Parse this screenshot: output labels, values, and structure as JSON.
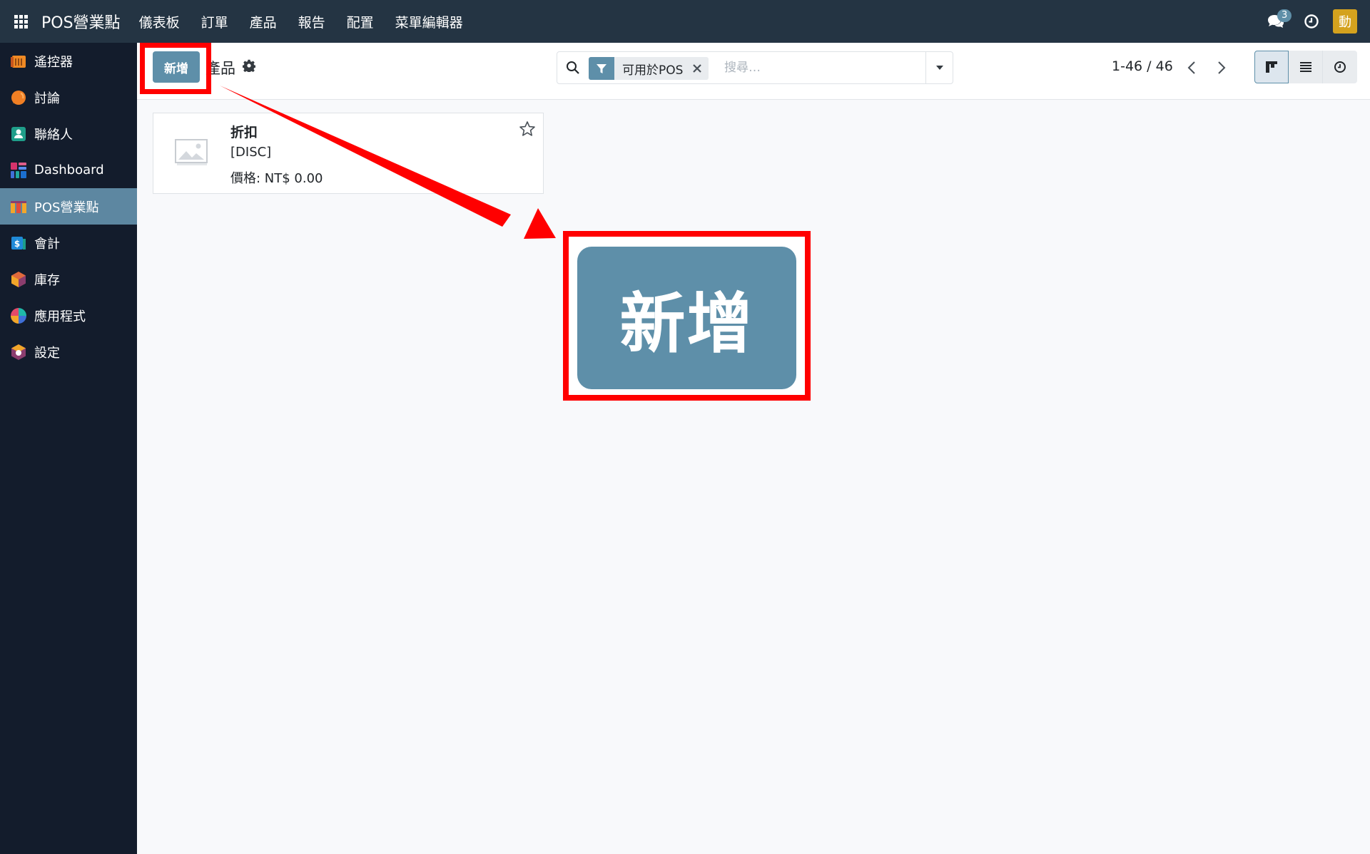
{
  "topbar": {
    "brand": "POS營業點",
    "menu": [
      "儀表板",
      "訂單",
      "產品",
      "報告",
      "配置",
      "菜單編輯器"
    ],
    "chat_count": "3",
    "avatar_letter": "動"
  },
  "sidebar": {
    "items": [
      {
        "label": "遙控器",
        "icon": "remote-icon"
      },
      {
        "label": "討論",
        "icon": "discuss-icon"
      },
      {
        "label": "聯絡人",
        "icon": "contacts-icon"
      },
      {
        "label": "Dashboard",
        "icon": "dashboard-icon"
      },
      {
        "label": "POS營業點",
        "icon": "pos-icon"
      },
      {
        "label": "會計",
        "icon": "accounting-icon"
      },
      {
        "label": "庫存",
        "icon": "inventory-icon"
      },
      {
        "label": "應用程式",
        "icon": "apps-icon"
      },
      {
        "label": "設定",
        "icon": "settings-icon"
      }
    ],
    "active_index": 4
  },
  "control": {
    "new_label": "新增",
    "breadcrumb": "產品",
    "search": {
      "facet_label": "可用於POS",
      "placeholder": "搜尋…"
    },
    "pager": "1-46 / 46"
  },
  "card": {
    "name": "折扣",
    "code": "[DISC]",
    "price": "價格: NT$ 0.00"
  },
  "zoom": {
    "label": "新增"
  },
  "colors": {
    "topbar": "#243443",
    "sidebar": "#131c2c",
    "primary": "#5e8fa9",
    "highlight": "#ff0000"
  }
}
